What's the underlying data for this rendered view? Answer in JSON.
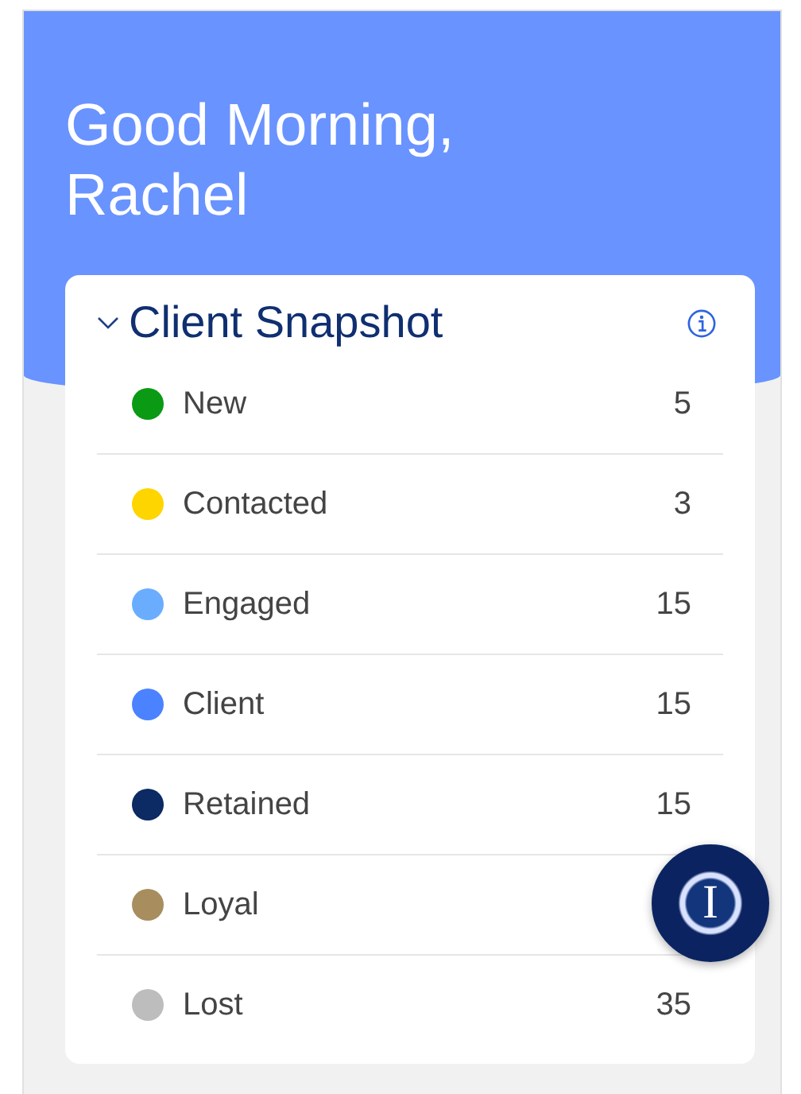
{
  "greeting": "Good Morning, Rachel",
  "snapshot": {
    "title": "Client Snapshot",
    "expanded": true,
    "items": [
      {
        "label": "New",
        "count": "5",
        "color": "#0a9a14"
      },
      {
        "label": "Contacted",
        "count": "3",
        "color": "#ffd500"
      },
      {
        "label": "Engaged",
        "count": "15",
        "color": "#6aadff"
      },
      {
        "label": "Client",
        "count": "15",
        "color": "#4a82ff"
      },
      {
        "label": "Retained",
        "count": "15",
        "color": "#0c2a63"
      },
      {
        "label": "Loyal",
        "color": "#a88d5e"
      },
      {
        "label": "Lost",
        "count": "35",
        "color": "#bdbdbd"
      }
    ]
  },
  "assistant_button": {
    "label": "I"
  }
}
